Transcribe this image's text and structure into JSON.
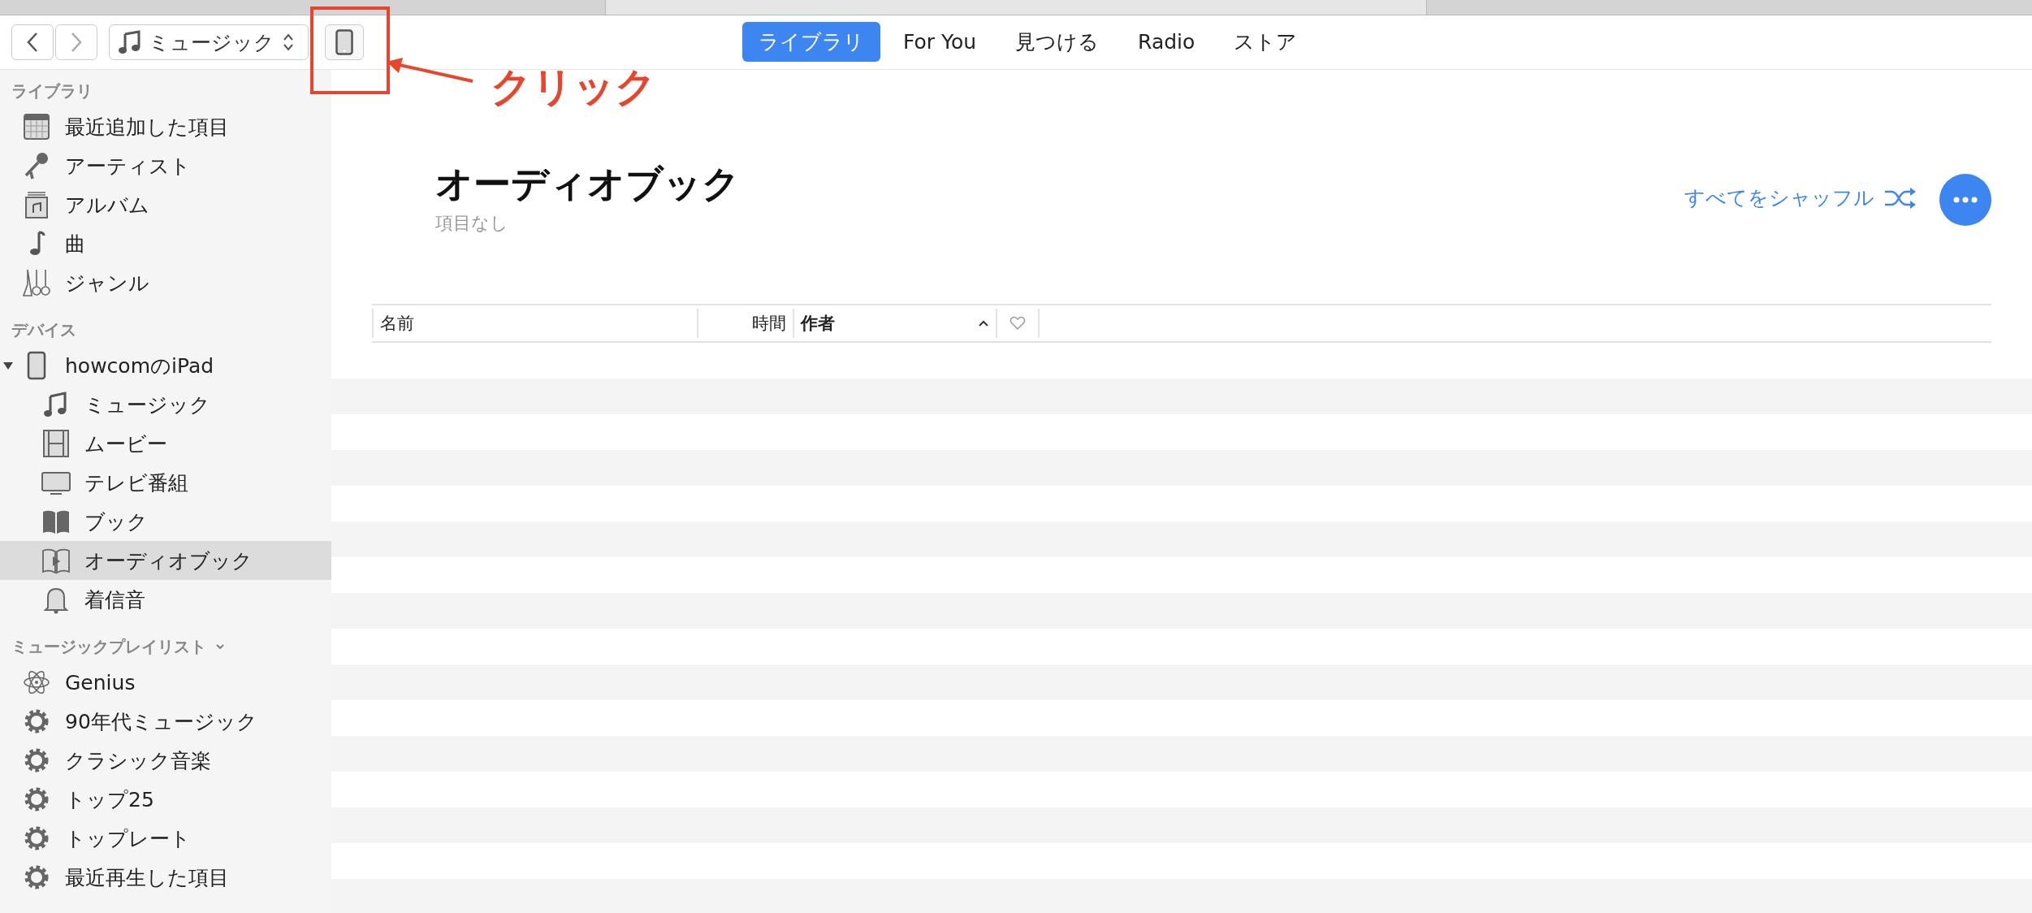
{
  "toolbar": {
    "source_picker": {
      "label": "ミュージック"
    }
  },
  "tabs": [
    {
      "label": "ライブラリ",
      "selected": true
    },
    {
      "label": "For You",
      "selected": false
    },
    {
      "label": "見つける",
      "selected": false
    },
    {
      "label": "Radio",
      "selected": false
    },
    {
      "label": "ストア",
      "selected": false
    }
  ],
  "annotation": {
    "label": "クリック"
  },
  "sidebar": {
    "sections": [
      {
        "title": "ライブラリ",
        "items": [
          {
            "label": "最近追加した項目",
            "kind": "grid",
            "selected": false
          },
          {
            "label": "アーティスト",
            "kind": "mic",
            "selected": false
          },
          {
            "label": "アルバム",
            "kind": "album",
            "selected": false
          },
          {
            "label": "曲",
            "kind": "note",
            "selected": false
          },
          {
            "label": "ジャンル",
            "kind": "guitars",
            "selected": false
          }
        ]
      },
      {
        "title": "デバイス",
        "items": [
          {
            "label": "howcomのiPad",
            "kind": "tablet",
            "selected": false,
            "expanded": true,
            "children": [
              {
                "label": "ミュージック",
                "kind": "notes",
                "selected": false
              },
              {
                "label": "ムービー",
                "kind": "film",
                "selected": false
              },
              {
                "label": "テレビ番組",
                "kind": "tv",
                "selected": false
              },
              {
                "label": "ブック",
                "kind": "book",
                "selected": false
              },
              {
                "label": "オーディオブック",
                "kind": "audiobook",
                "selected": true
              },
              {
                "label": "着信音",
                "kind": "bell",
                "selected": false
              }
            ]
          }
        ]
      },
      {
        "title": "ミュージックプレイリスト",
        "expanded": true,
        "items": [
          {
            "label": "Genius",
            "kind": "atom",
            "selected": false
          },
          {
            "label": "90年代ミュージック",
            "kind": "gear",
            "selected": false
          },
          {
            "label": "クラシック音楽",
            "kind": "gear",
            "selected": false
          },
          {
            "label": "トップ25",
            "kind": "gear",
            "selected": false
          },
          {
            "label": "トップレート",
            "kind": "gear",
            "selected": false
          },
          {
            "label": "最近再生した項目",
            "kind": "gear",
            "selected": false
          }
        ]
      }
    ]
  },
  "content": {
    "title": "オーディオブック",
    "subtitle": "項目なし",
    "shuffle_label": "すべてをシャッフル"
  },
  "table": {
    "columns": [
      {
        "kind": "text",
        "label": "名前",
        "sorted": false
      },
      {
        "kind": "text",
        "label": "時間",
        "sorted": false
      },
      {
        "kind": "text",
        "label": "作者",
        "sorted": true
      },
      {
        "kind": "heart"
      }
    ]
  }
}
